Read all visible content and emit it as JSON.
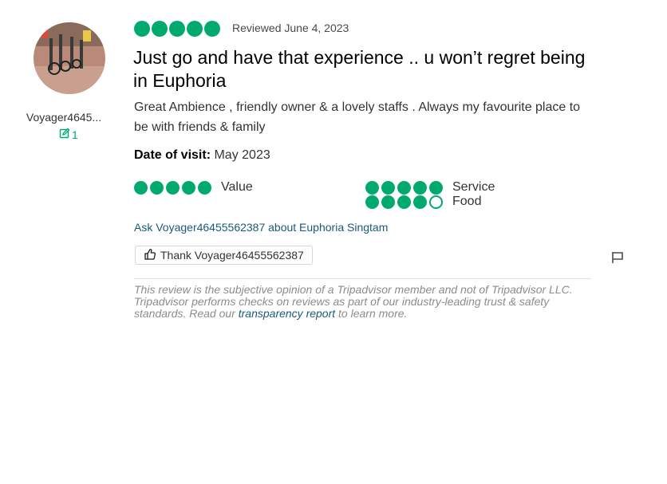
{
  "reviewer": {
    "username": "Voyager4645...",
    "contributions": "1"
  },
  "review": {
    "rating": 5,
    "reviewed_date": "Reviewed June 4, 2023",
    "title": "Just go and have that experience .. u won’t regret being in Euphoria",
    "body": "Great Ambience , friendly owner & a lovely staffs . Always my favourite place to be with friends & family",
    "date_of_visit_label": "Date of visit:",
    "date_of_visit_value": "May 2023"
  },
  "sub_ratings": [
    {
      "label": "Value",
      "rating": 5
    },
    {
      "label": "Service",
      "rating": 5
    },
    {
      "label": "Food",
      "rating": 4
    }
  ],
  "actions": {
    "ask_link": "Ask Voyager46455562387 about Euphoria Singtam",
    "thank_label": "Thank Voyager46455562387"
  },
  "disclaimer": {
    "text_before": "This review is the subjective opinion of a Tripadvisor member and not of Tripadvisor LLC. Tripadvisor performs checks on reviews as part of our industry-leading trust & safety standards. Read our ",
    "link": "transparency report",
    "text_after": " to learn more."
  },
  "colors": {
    "accent": "#00aa6c",
    "link": "#1a5a7a"
  },
  "icons": [
    "pencil-icon",
    "thumbs-up-icon",
    "flag-icon"
  ]
}
